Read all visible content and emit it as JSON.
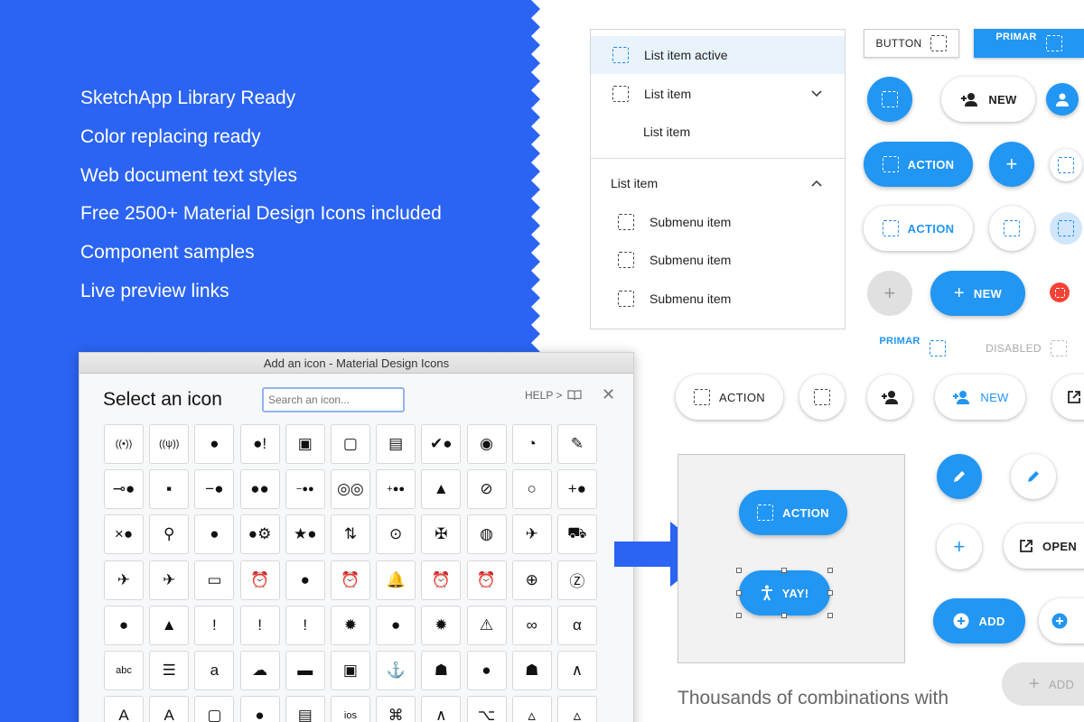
{
  "features": [
    "SketchApp Library Ready",
    "Color replacing ready",
    "Web document text styles",
    "Free 2500+ Material Design Icons included",
    "Component samples",
    "Live preview links"
  ],
  "dialog": {
    "title": "Add an icon - Material Design Icons",
    "heading": "Select an icon",
    "search_placeholder": "Search an icon...",
    "help": "HELP >",
    "close": "✕",
    "icons": [
      "((•))",
      "((ψ))",
      "●",
      "●!",
      "▣",
      "▢",
      "▤",
      "✔●",
      "◉",
      "◔",
      "✎",
      "⊸●",
      "▪",
      "−●",
      "●●",
      "−●●",
      "◎◎",
      "+●●",
      "▲",
      "⊘",
      "○",
      "+●",
      "×●",
      "⚲",
      "●",
      "●⚙",
      "★●",
      "⇅",
      "⊙",
      "✠",
      "◍",
      "✈",
      "⛟",
      "✈",
      "✈",
      "▭",
      "⏰",
      "●",
      "⏰",
      "🔔",
      "⏰",
      "⏰",
      "⊕",
      "Ⓩ",
      "●",
      "▲",
      "!",
      "!",
      "!",
      "✹",
      "●",
      "✹",
      "⚠",
      "∞",
      "α",
      "abc",
      "☰",
      "a",
      "☁",
      "▬",
      "▣",
      "⚓",
      "☗",
      "●",
      "☗",
      "∧",
      "A",
      "A",
      "▢",
      "●",
      "▤",
      "ios",
      "⌘",
      "∧",
      "⌥",
      "▵",
      "▵"
    ]
  },
  "list": {
    "item_active": "List item active",
    "item_dropdown": "List item",
    "item_plain": "List item",
    "section_header": "List item",
    "submenu": [
      "Submenu item",
      "Submenu item",
      "Submenu item"
    ]
  },
  "buttons": {
    "button": "BUTTON",
    "primary": "PRIMAR",
    "new": "NEW",
    "action": "ACTION",
    "new2": "NEW",
    "disabled": "DISABLED",
    "action_row": "ACTION",
    "new_row": "NEW",
    "open": "OPEN",
    "add": "ADD",
    "add_disabled": "ADD",
    "plus": "+"
  },
  "canvas": {
    "action": "ACTION",
    "yay": "YAY!"
  },
  "bottom_text": "Thousands of combinations with",
  "colors": {
    "panel_blue": "#2b64f2",
    "material_blue": "#2196f3",
    "active_bg": "#e8f3fc",
    "error_red": "#f44336"
  }
}
